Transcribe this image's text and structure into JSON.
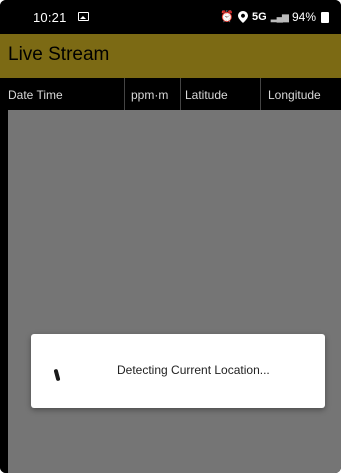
{
  "status_bar": {
    "time": "10:21",
    "network": "5G",
    "battery": "94%"
  },
  "app_bar": {
    "title": "Live Stream",
    "color": "#7c6a14"
  },
  "table": {
    "columns": [
      "Date Time",
      "ppm·m",
      "Latitude",
      "Longitude"
    ],
    "rows": []
  },
  "dialog": {
    "message": "Detecting Current Location..."
  }
}
